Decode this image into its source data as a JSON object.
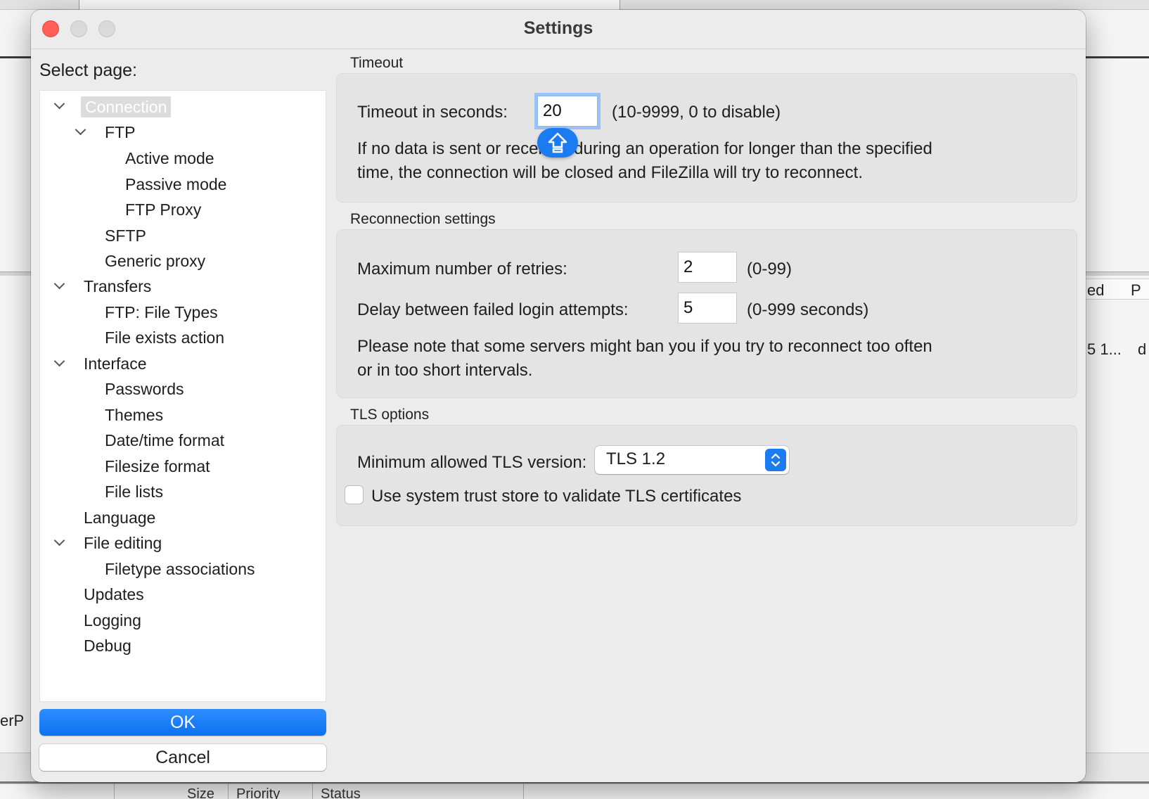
{
  "background": {
    "right_header": "ed",
    "right_header_2": "P",
    "right_cell": "5 1...",
    "right_cell_2": "d",
    "left_cell": "erP",
    "bottom_headers": [
      "Size",
      "Priority",
      "Status"
    ]
  },
  "dialog": {
    "title": "Settings",
    "select_page_label": "Select page:",
    "tree": [
      {
        "label": "Connection",
        "level": 0,
        "expanded": true,
        "selected": true
      },
      {
        "label": "FTP",
        "level": 1,
        "expanded": true
      },
      {
        "label": "Active mode",
        "level": 2
      },
      {
        "label": "Passive mode",
        "level": 2
      },
      {
        "label": "FTP Proxy",
        "level": 2
      },
      {
        "label": "SFTP",
        "level": 1
      },
      {
        "label": "Generic proxy",
        "level": 1
      },
      {
        "label": "Transfers",
        "level": 0,
        "expanded": true
      },
      {
        "label": "FTP: File Types",
        "level": 1
      },
      {
        "label": "File exists action",
        "level": 1
      },
      {
        "label": "Interface",
        "level": 0,
        "expanded": true
      },
      {
        "label": "Passwords",
        "level": 1
      },
      {
        "label": "Themes",
        "level": 1
      },
      {
        "label": "Date/time format",
        "level": 1
      },
      {
        "label": "Filesize format",
        "level": 1
      },
      {
        "label": "File lists",
        "level": 1
      },
      {
        "label": "Language",
        "level": 0
      },
      {
        "label": "File editing",
        "level": 0,
        "expanded": true
      },
      {
        "label": "Filetype associations",
        "level": 1
      },
      {
        "label": "Updates",
        "level": 0
      },
      {
        "label": "Logging",
        "level": 0
      },
      {
        "label": "Debug",
        "level": 0
      }
    ],
    "ok_label": "OK",
    "cancel_label": "Cancel"
  },
  "timeout": {
    "section_title": "Timeout",
    "label": "Timeout in seconds:",
    "value": "20",
    "range_hint": "(10-9999, 0 to disable)",
    "description_line1": "If no data is sent or received during an operation for longer than the specified",
    "description_line2": "time, the connection will be closed and FileZilla will try to reconnect."
  },
  "reconnection": {
    "section_title": "Reconnection settings",
    "retries_label": "Maximum number of retries:",
    "retries_value": "2",
    "retries_hint": "(0-99)",
    "delay_label": "Delay between failed login attempts:",
    "delay_value": "5",
    "delay_hint": "(0-999 seconds)",
    "note_line1": "Please note that some servers might ban you if you try to reconnect too often",
    "note_line2": "or in too short intervals."
  },
  "tls": {
    "section_title": "TLS options",
    "min_version_label": "Minimum allowed TLS version:",
    "min_version_value": "TLS 1.2",
    "system_trust_label": "Use system trust store to validate TLS certificates",
    "system_trust_checked": false
  },
  "colors": {
    "accent": "#0a72f0",
    "close": "#ff5f57"
  },
  "icons": {
    "caps_lock": "caps-lock-icon",
    "chevron": "chevron-down-icon",
    "stepper": "up-down-chevron-icon"
  }
}
